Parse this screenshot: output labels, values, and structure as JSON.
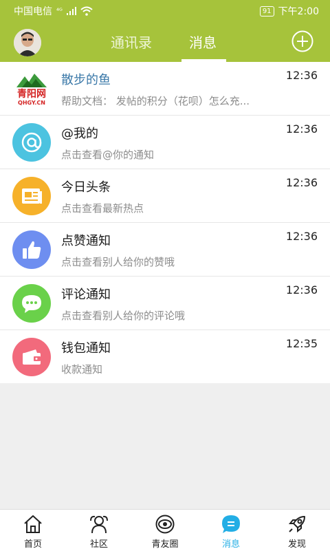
{
  "status_bar": {
    "carrier": "中国电信",
    "signal_label": "⁴ᴳ",
    "battery": "91",
    "time": "下午2:00"
  },
  "header": {
    "tabs": [
      {
        "label": "通讯录"
      },
      {
        "label": "消息"
      }
    ],
    "active_tab": "消息"
  },
  "messages": [
    {
      "title": "散步的鱼",
      "subtitle": "帮助文档： 发帖的积分（花呗）怎么充...",
      "time": "12:36",
      "logo_top": "青阳网",
      "logo_bottom": "QHGY.CN"
    },
    {
      "title": "@我的",
      "subtitle": "点击查看@你的通知",
      "time": "12:36",
      "icon": "at-icon",
      "color": "#4cc3e0"
    },
    {
      "title": "今日头条",
      "subtitle": "点击查看最新热点",
      "time": "12:36",
      "icon": "newspaper-icon",
      "color": "#f6b12a"
    },
    {
      "title": "点赞通知",
      "subtitle": "点击查看别人给你的赞哦",
      "time": "12:36",
      "icon": "thumbs-up-icon",
      "color": "#6e8ef0"
    },
    {
      "title": "评论通知",
      "subtitle": "点击查看别人给你的评论哦",
      "time": "12:36",
      "icon": "comment-icon",
      "color": "#6ad14a"
    },
    {
      "title": "钱包通知",
      "subtitle": "收款通知",
      "time": "12:35",
      "icon": "wallet-icon",
      "color": "#f26a7c"
    }
  ],
  "tab_bar": {
    "items": [
      {
        "label": "首页",
        "icon": "home-icon"
      },
      {
        "label": "社区",
        "icon": "community-icon"
      },
      {
        "label": "青友圈",
        "icon": "camera-icon"
      },
      {
        "label": "消息",
        "icon": "message-icon"
      },
      {
        "label": "发现",
        "icon": "rocket-icon"
      }
    ],
    "active": "消息",
    "active_color": "#23aee5"
  },
  "colors": {
    "accent": "#a6c33b"
  }
}
